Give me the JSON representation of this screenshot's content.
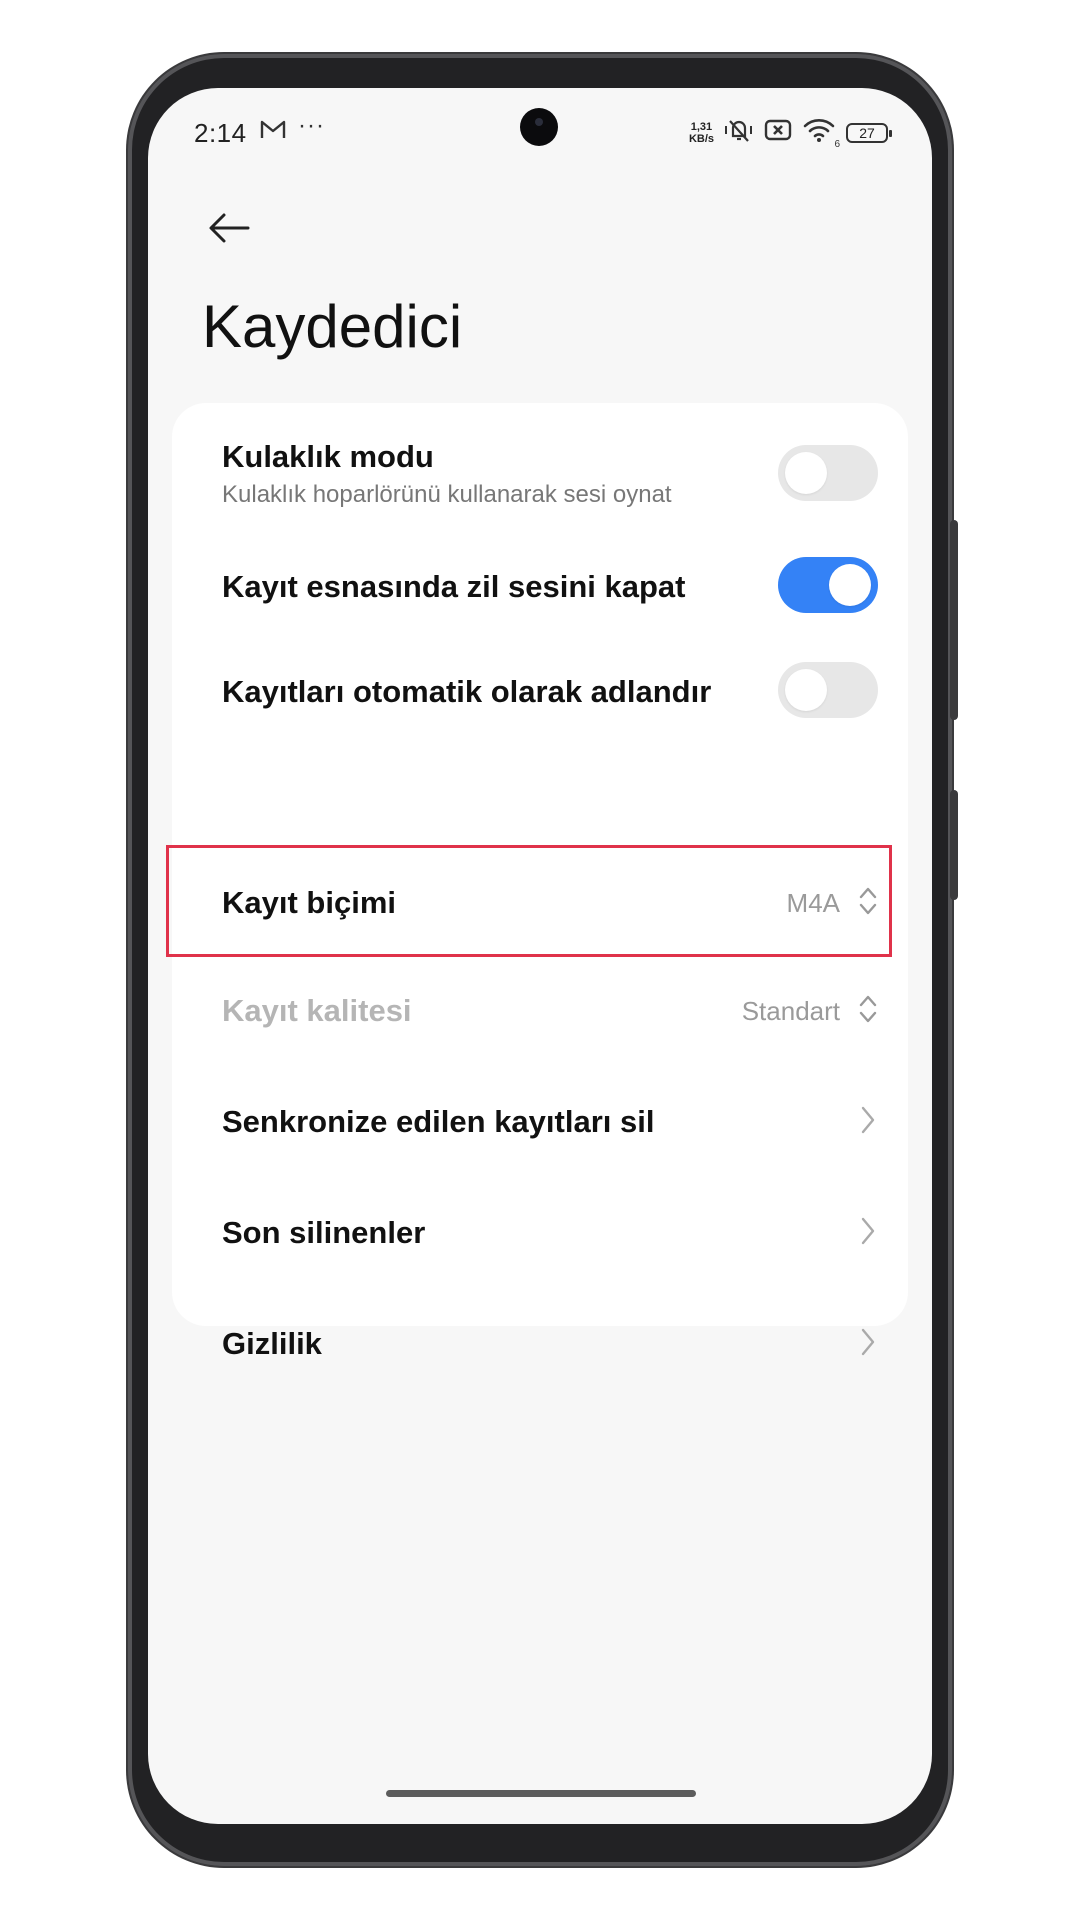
{
  "status_bar": {
    "time": "2:14",
    "dots": "···",
    "net_speed_value": "1,31",
    "net_speed_unit": "KB/s",
    "wifi_sub": "6",
    "battery": "27",
    "icons": [
      "gmail-icon",
      "vibrate-icon",
      "no-sim-icon",
      "wifi-icon",
      "battery-icon"
    ]
  },
  "header": {
    "back_icon": "arrow-left-icon",
    "title": "Kaydedici"
  },
  "settings": {
    "headphone_mode": {
      "title": "Kulaklık modu",
      "subtitle": "Kulaklık hoparlörünü kullanarak sesi oynat",
      "enabled": false
    },
    "mute_ringer": {
      "title": "Kayıt esnasında zil sesini kapat",
      "enabled": true
    },
    "auto_name": {
      "title": "Kayıtları otomatik olarak adlandır",
      "enabled": false
    },
    "format": {
      "title": "Kayıt biçimi",
      "value": "M4A"
    },
    "quality": {
      "title": "Kayıt kalitesi",
      "value": "Standart",
      "disabled": true
    },
    "delete_synced": {
      "title": "Senkronize edilen kayıtları sil"
    },
    "recently_deleted": {
      "title": "Son silinenler"
    },
    "privacy": {
      "title": "Gizlilik"
    }
  },
  "colors": {
    "accent": "#3482f6",
    "highlight_border": "#e0324a",
    "background": "#f7f7f7",
    "card": "#ffffff"
  }
}
